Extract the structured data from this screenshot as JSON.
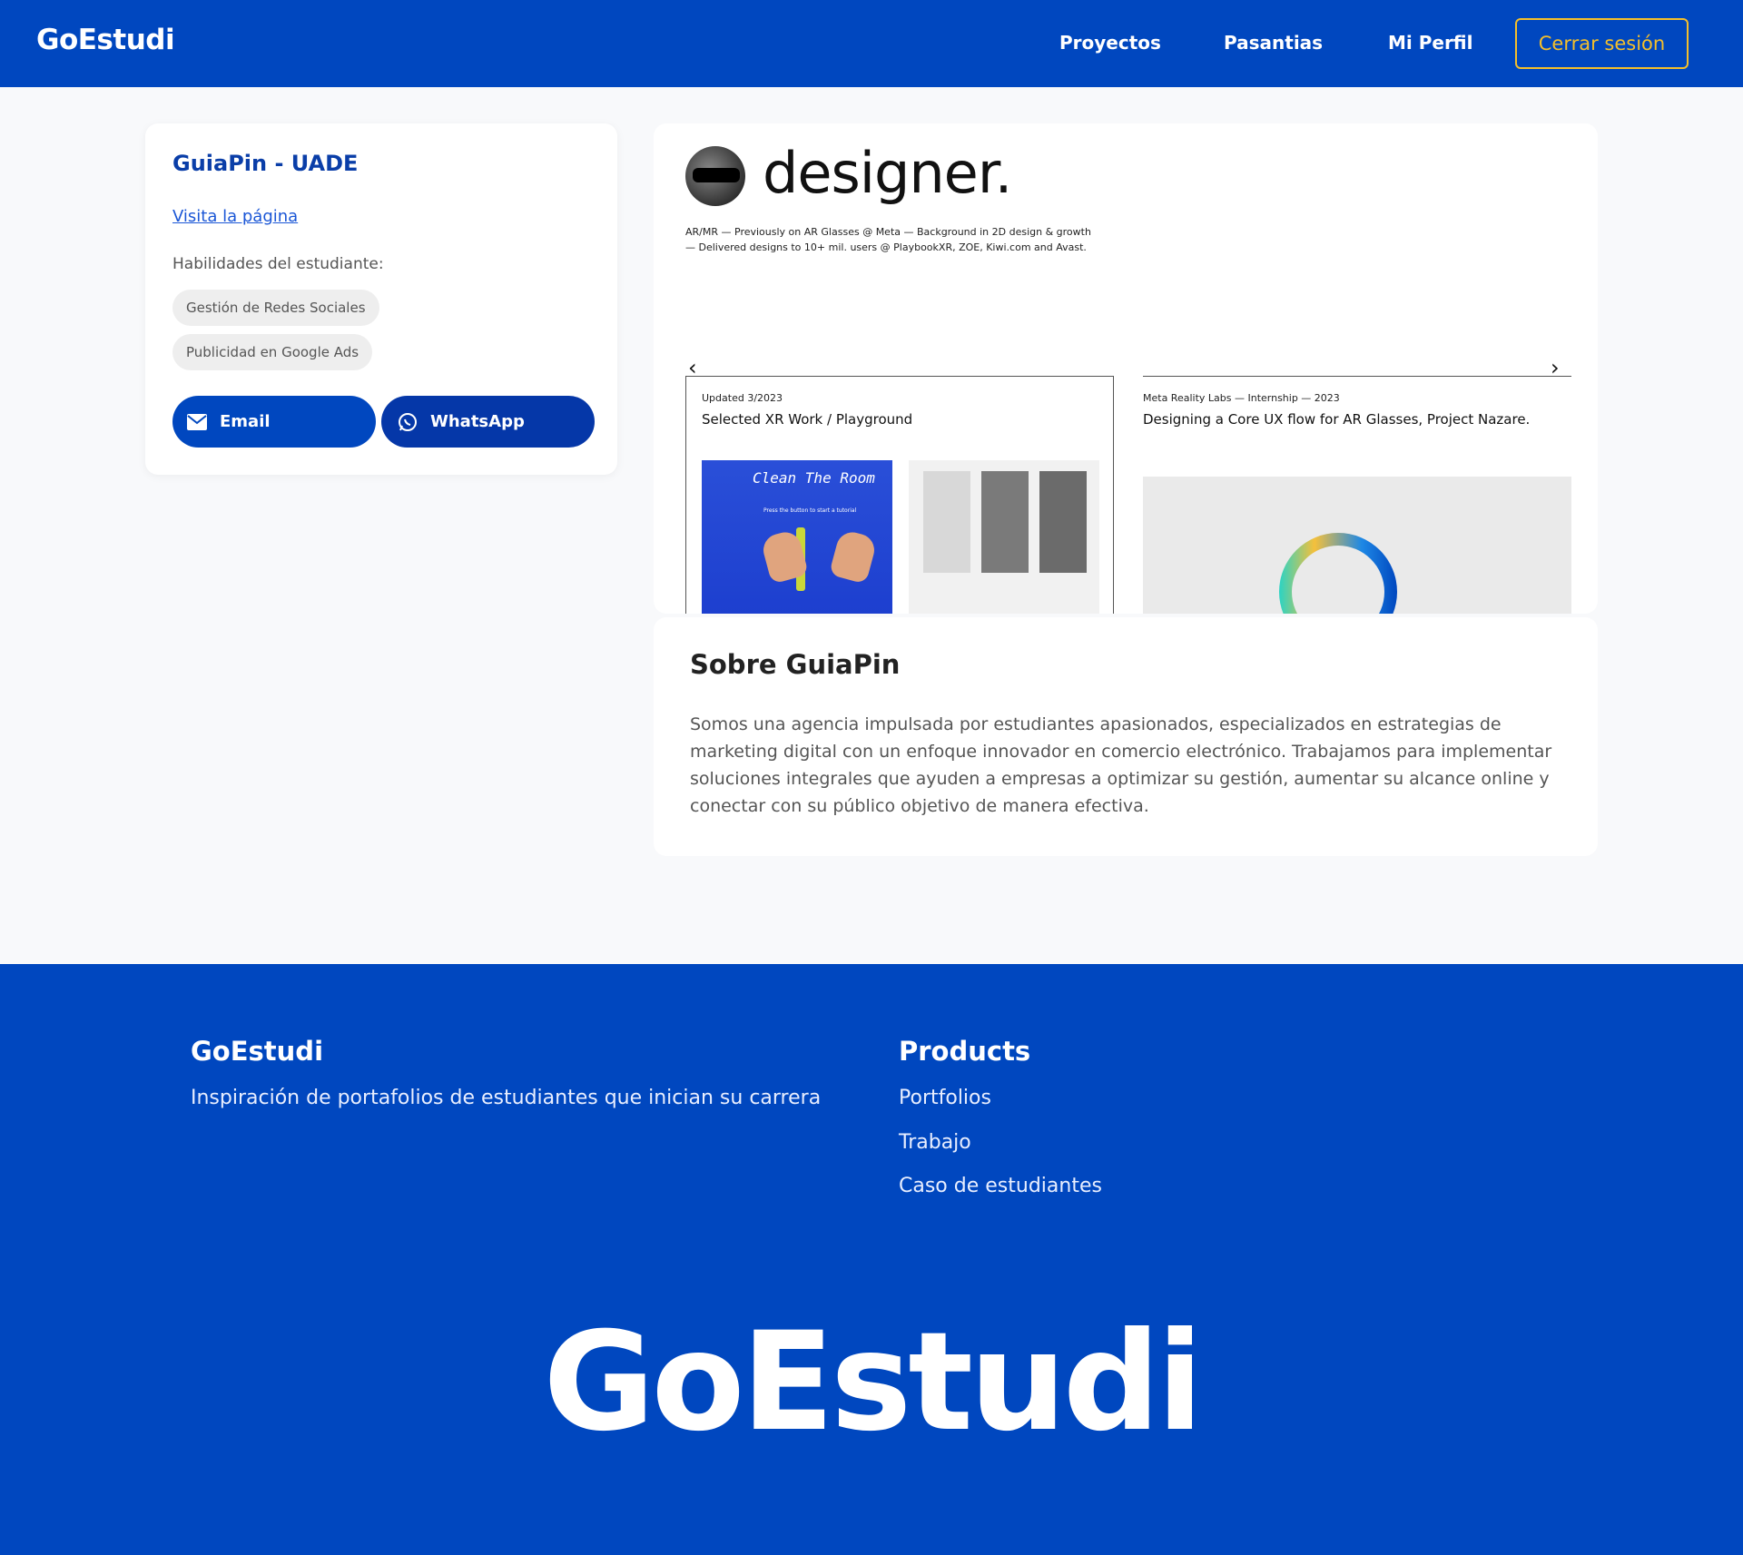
{
  "header": {
    "brand": "GoEstudi",
    "nav": [
      "Proyectos",
      "Pasantias",
      "Mi Perfil"
    ],
    "logout_label": "Cerrar sesión"
  },
  "profile": {
    "title": "GuiaPin - UADE",
    "visit_link": "Visita la página",
    "skills_label": "Habilidades del estudiante:",
    "skills": [
      "Gestión de Redes Sociales",
      "Publicidad en Google Ads"
    ],
    "email_label": "Email",
    "whatsapp_label": "WhatsApp"
  },
  "preview": {
    "headline": "designer.",
    "blurb": "AR/MR — Previously on AR Glasses @ Meta — Background in 2D design & growth — Delivered designs to 10+ mil. users @ PlaybookXR, ZOE, Kiwi.com and Avast.",
    "prev_arrow": "‹",
    "next_arrow": "›",
    "projects": [
      {
        "meta": "Updated 3/2023",
        "title": "Selected XR Work / Playground",
        "thumb_text": "Clean The Room",
        "thumb_subtext": "Press the button to start a tutorial"
      },
      {
        "meta": "Meta Reality Labs — Internship — 2023",
        "title": "Designing a Core UX flow for AR Glasses, Project Nazare."
      }
    ]
  },
  "about": {
    "title": "Sobre GuiaPin",
    "text": "Somos una agencia impulsada por estudiantes apasionados, especializados en estrategias de marketing digital con un enfoque innovador en comercio electrónico. Trabajamos para implementar soluciones integrales que ayuden a empresas a optimizar su gestión, aumentar su alcance online y conectar con su público objetivo de manera efectiva."
  },
  "footer": {
    "brand": "GoEstudi",
    "tagline": "Inspiración de portafolios de estudiantes que inician su carrera",
    "products_title": "Products",
    "links": [
      "Portfolios",
      "Trabajo",
      "Caso de estudiantes"
    ],
    "big_brand": "GoEstudi"
  },
  "colors": {
    "primary": "#0047bf",
    "accent": "#f5bf2a",
    "background": "#f8f9fb"
  },
  "icons": {
    "email": "envelope-icon",
    "whatsapp": "whatsapp-icon"
  }
}
